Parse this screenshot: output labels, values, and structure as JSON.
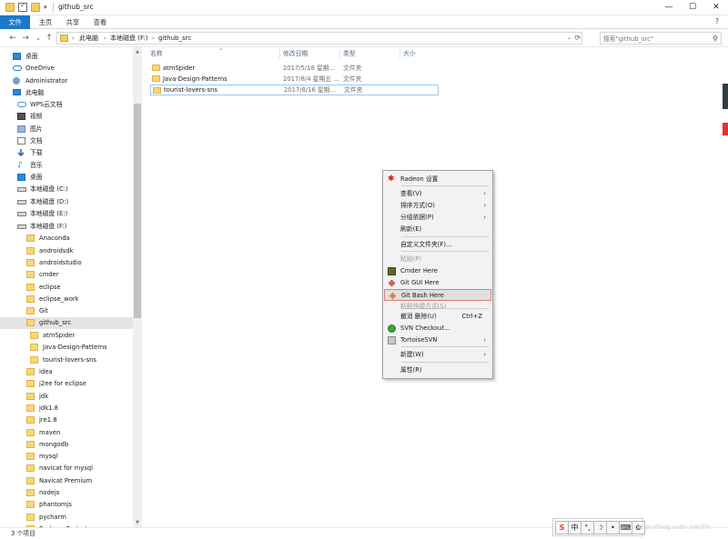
{
  "window": {
    "title": "github_src",
    "controls": {
      "minimize": "—",
      "maximize": "☐",
      "close": "✕"
    }
  },
  "quick_access": {
    "caret": "▾"
  },
  "ribbon": {
    "tabs": [
      {
        "label": "文件"
      },
      {
        "label": "主页"
      },
      {
        "label": "共享"
      },
      {
        "label": "查看"
      }
    ],
    "help": "?"
  },
  "address": {
    "back": "←",
    "forward": "→",
    "recent": "⌄",
    "up": "↑",
    "crumbs": [
      "此电脑",
      "本地磁盘 (F:)",
      "github_src"
    ],
    "separator": "›",
    "dropdown": "⌄",
    "refresh": "⟳"
  },
  "search": {
    "placeholder": "搜索\"github_src\"",
    "icon": "⚲"
  },
  "navpane": {
    "items": [
      {
        "label": "桌面",
        "icon": "desktop-icon"
      },
      {
        "label": "OneDrive",
        "icon": "cloud-icon"
      },
      {
        "label": "Administrator",
        "icon": "user-icon"
      },
      {
        "label": "此电脑",
        "icon": "computer-icon"
      },
      {
        "label": "WPS云文档",
        "icon": "cloud-icon"
      },
      {
        "label": "视频",
        "icon": "video-icon"
      },
      {
        "label": "图片",
        "icon": "picture-icon"
      },
      {
        "label": "文档",
        "icon": "document-icon"
      },
      {
        "label": "下载",
        "icon": "download-icon"
      },
      {
        "label": "音乐",
        "icon": "music-icon"
      },
      {
        "label": "桌面",
        "icon": "desktop-icon"
      },
      {
        "label": "本地磁盘 (C:)",
        "icon": "drive-icon"
      },
      {
        "label": "本地磁盘 (D:)",
        "icon": "drive-icon"
      },
      {
        "label": "本地磁盘 (E:)",
        "icon": "drive-icon"
      },
      {
        "label": "本地磁盘 (F:)",
        "icon": "drive-icon"
      },
      {
        "label": "Anaconda",
        "icon": "folder-icon"
      },
      {
        "label": "androidsdk",
        "icon": "folder-icon"
      },
      {
        "label": "androidstudio",
        "icon": "folder-icon"
      },
      {
        "label": "cmder",
        "icon": "folder-icon"
      },
      {
        "label": "eclipse",
        "icon": "folder-icon"
      },
      {
        "label": "eclipse_work",
        "icon": "folder-icon"
      },
      {
        "label": "Git",
        "icon": "folder-icon"
      },
      {
        "label": "github_src",
        "icon": "folder-icon",
        "selected": true
      },
      {
        "label": "atmSpider",
        "icon": "folder-icon"
      },
      {
        "label": "Java-Design-Patterns",
        "icon": "folder-icon"
      },
      {
        "label": "tourist-lovers-sns",
        "icon": "folder-icon"
      },
      {
        "label": "idea",
        "icon": "folder-icon"
      },
      {
        "label": "j2ee for eclipse",
        "icon": "folder-icon"
      },
      {
        "label": "jdk",
        "icon": "folder-icon"
      },
      {
        "label": "jdk1.8",
        "icon": "folder-icon"
      },
      {
        "label": "jre1.8",
        "icon": "folder-icon"
      },
      {
        "label": "maven",
        "icon": "folder-icon"
      },
      {
        "label": "mongodb",
        "icon": "folder-icon"
      },
      {
        "label": "mysql",
        "icon": "folder-icon"
      },
      {
        "label": "navicat for mysql",
        "icon": "folder-icon"
      },
      {
        "label": "Navicat Premium",
        "icon": "folder-icon"
      },
      {
        "label": "nodejs",
        "icon": "folder-icon"
      },
      {
        "label": "phantomjs",
        "icon": "folder-icon"
      },
      {
        "label": "pycharm",
        "icon": "folder-icon"
      },
      {
        "label": "PycharmProject",
        "icon": "folder-icon"
      }
    ],
    "scroll_up": "▲",
    "scroll_down": "▼"
  },
  "columns": {
    "name": "名称",
    "date": "修改日期",
    "type": "类型",
    "size": "大小",
    "sort_indicator": "^"
  },
  "files": [
    {
      "name": "atmSpider",
      "date": "2017/5/18 星期...",
      "type": "文件夹"
    },
    {
      "name": "Java-Design-Patterns",
      "date": "2017/8/4 星期五 ...",
      "type": "文件夹"
    },
    {
      "name": "tourist-lovers-sns",
      "date": "2017/8/16 星期...",
      "type": "文件夹"
    }
  ],
  "status": {
    "count": "3 个项目"
  },
  "context_menu": {
    "items": [
      {
        "label": "Radeon 设置",
        "icon": "radeon-icon"
      },
      {
        "label": "查看(V)",
        "arrow": "›"
      },
      {
        "label": "排序方式(O)",
        "arrow": "›"
      },
      {
        "label": "分组依据(P)",
        "arrow": "›"
      },
      {
        "label": "刷新(E)"
      },
      {
        "label": "自定义文件夹(F)..."
      },
      {
        "label": "粘贴(P)",
        "disabled": true
      },
      {
        "label": "Cmder Here",
        "icon": "cmder-icon"
      },
      {
        "label": "Git GUI Here",
        "icon": "git-gui-icon"
      },
      {
        "label": "Git Bash Here",
        "icon": "git-bash-icon",
        "highlighted": true
      },
      {
        "label": "粘贴快捷方式(S)",
        "disabled": true
      },
      {
        "label": "撤消 删除(U)",
        "shortcut": "Ctrl+Z"
      },
      {
        "label": "SVN Checkout...",
        "icon": "svn-icon"
      },
      {
        "label": "TortoiseSVN",
        "icon": "tortoisesvn-icon",
        "arrow": "›"
      },
      {
        "label": "新建(W)",
        "arrow": "›"
      },
      {
        "label": "属性(R)"
      }
    ]
  },
  "tray": {
    "buttons": [
      "S",
      "中",
      "°,",
      "☽",
      "•",
      "⌨",
      "⚙"
    ]
  },
  "watermark": "http://blog.csdn.net/Dh",
  "colors": {
    "accent": "#1979ca",
    "folder": "#f8d775",
    "selection": "#e5e5e5",
    "menu_highlight_border": "#e07a7a"
  }
}
